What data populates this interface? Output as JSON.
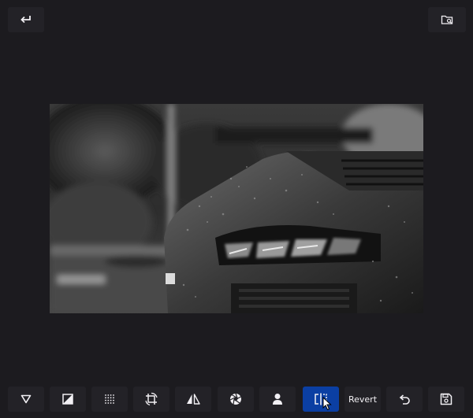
{
  "header": {
    "back_icon": "return-arrow-icon",
    "folder_icon": "folder-search-icon"
  },
  "image": {
    "description_icon": "photo-preview"
  },
  "toolbar": {
    "items": [
      {
        "icon": "triangle-down-icon"
      },
      {
        "icon": "image-filter-icon"
      },
      {
        "icon": "grain-dots-icon"
      },
      {
        "icon": "crop-rotate-icon"
      },
      {
        "icon": "flip-icon"
      },
      {
        "icon": "aperture-icon"
      },
      {
        "icon": "person-icon"
      },
      {
        "icon": "compare-split-icon",
        "active": true
      },
      {
        "label": "Revert"
      },
      {
        "icon": "undo-icon"
      },
      {
        "icon": "save-icon"
      }
    ],
    "revert_label": "Revert"
  },
  "colors": {
    "background": "#1c1b1f",
    "button": "#232227",
    "active": "#0b3fa3"
  }
}
